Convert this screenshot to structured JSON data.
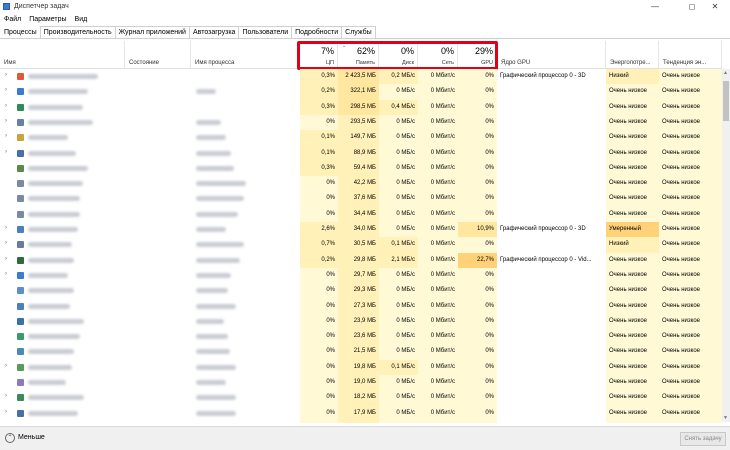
{
  "window": {
    "title": "Диспетчер задач"
  },
  "menu": [
    "Файл",
    "Параметры",
    "Вид"
  ],
  "tabs": [
    "Процессы",
    "Производительность",
    "Журнал приложений",
    "Автозагрузка",
    "Пользователи",
    "Подробности",
    "Службы"
  ],
  "header": {
    "name": "Имя",
    "status": "Состояние",
    "process_name": "Имя процесса",
    "cpu": {
      "pct": "7%",
      "label": "ЦП"
    },
    "mem": {
      "pct": "62%",
      "label": "Память"
    },
    "disk": {
      "pct": "0%",
      "label": "Диск"
    },
    "net": {
      "pct": "0%",
      "label": "Сеть"
    },
    "gpu": {
      "pct": "29%",
      "label": "GPU"
    },
    "gpu_engine": "Ядро GPU",
    "power": "Энергопотре...",
    "power_trend": "Тенденция эн..."
  },
  "rows": [
    {
      "cpu": "0,3%",
      "mem": "2 423,5 МБ",
      "disk": "0,2 МБ/с",
      "net": "0 Мбит/с",
      "gpu": "0%",
      "engine": "Графический процессор 0 - 3D",
      "power": "Низкий",
      "trend": "Очень низкое"
    },
    {
      "cpu": "0,2%",
      "mem": "322,1 МБ",
      "disk": "0 МБ/с",
      "net": "0 Мбит/с",
      "gpu": "0%",
      "engine": "",
      "power": "Очень низкое",
      "trend": "Очень низкое"
    },
    {
      "cpu": "0,3%",
      "mem": "298,5 МБ",
      "disk": "0,4 МБ/с",
      "net": "0 Мбит/с",
      "gpu": "0%",
      "engine": "",
      "power": "Очень низкое",
      "trend": "Очень низкое"
    },
    {
      "cpu": "0%",
      "mem": "293,5 МБ",
      "disk": "0 МБ/с",
      "net": "0 Мбит/с",
      "gpu": "0%",
      "engine": "",
      "power": "Очень низкое",
      "trend": "Очень низкое"
    },
    {
      "cpu": "0,1%",
      "mem": "149,7 МБ",
      "disk": "0 МБ/с",
      "net": "0 Мбит/с",
      "gpu": "0%",
      "engine": "",
      "power": "Очень низкое",
      "trend": "Очень низкое"
    },
    {
      "cpu": "0,1%",
      "mem": "88,9 МБ",
      "disk": "0 МБ/с",
      "net": "0 Мбит/с",
      "gpu": "0%",
      "engine": "",
      "power": "Очень низкое",
      "trend": "Очень низкое"
    },
    {
      "cpu": "0,3%",
      "mem": "59,4 МБ",
      "disk": "0 МБ/с",
      "net": "0 Мбит/с",
      "gpu": "0%",
      "engine": "",
      "power": "Очень низкое",
      "trend": "Очень низкое"
    },
    {
      "cpu": "0%",
      "mem": "42,2 МБ",
      "disk": "0 МБ/с",
      "net": "0 Мбит/с",
      "gpu": "0%",
      "engine": "",
      "power": "Очень низкое",
      "trend": "Очень низкое"
    },
    {
      "cpu": "0%",
      "mem": "37,6 МБ",
      "disk": "0 МБ/с",
      "net": "0 Мбит/с",
      "gpu": "0%",
      "engine": "",
      "power": "Очень низкое",
      "trend": "Очень низкое"
    },
    {
      "cpu": "0%",
      "mem": "34,4 МБ",
      "disk": "0 МБ/с",
      "net": "0 Мбит/с",
      "gpu": "0%",
      "engine": "",
      "power": "Очень низкое",
      "trend": "Очень низкое"
    },
    {
      "cpu": "2,6%",
      "mem": "34,0 МБ",
      "disk": "0 МБ/с",
      "net": "0 Мбит/с",
      "gpu": "10,9%",
      "engine": "Графический процессор 0 - 3D",
      "power": "Умеренный",
      "trend": "Очень низкое"
    },
    {
      "cpu": "0,7%",
      "mem": "30,5 МБ",
      "disk": "0,1 МБ/с",
      "net": "0 Мбит/с",
      "gpu": "0%",
      "engine": "",
      "power": "Низкий",
      "trend": "Очень низкое"
    },
    {
      "cpu": "0,2%",
      "mem": "29,8 МБ",
      "disk": "2,1 МБ/с",
      "net": "0 Мбит/с",
      "gpu": "22,7%",
      "engine": "Графический процессор 0 - Vid...",
      "power": "Очень низкое",
      "trend": "Очень низкое"
    },
    {
      "cpu": "0%",
      "mem": "29,7 МБ",
      "disk": "0 МБ/с",
      "net": "0 Мбит/с",
      "gpu": "0%",
      "engine": "",
      "power": "Очень низкое",
      "trend": "Очень низкое"
    },
    {
      "cpu": "0%",
      "mem": "29,3 МБ",
      "disk": "0 МБ/с",
      "net": "0 Мбит/с",
      "gpu": "0%",
      "engine": "",
      "power": "Очень низкое",
      "trend": "Очень низкое"
    },
    {
      "cpu": "0%",
      "mem": "27,3 МБ",
      "disk": "0 МБ/с",
      "net": "0 Мбит/с",
      "gpu": "0%",
      "engine": "",
      "power": "Очень низкое",
      "trend": "Очень низкое"
    },
    {
      "cpu": "0%",
      "mem": "23,9 МБ",
      "disk": "0 МБ/с",
      "net": "0 Мбит/с",
      "gpu": "0%",
      "engine": "",
      "power": "Очень низкое",
      "trend": "Очень низкое"
    },
    {
      "cpu": "0%",
      "mem": "23,6 МБ",
      "disk": "0 МБ/с",
      "net": "0 Мбит/с",
      "gpu": "0%",
      "engine": "",
      "power": "Очень низкое",
      "trend": "Очень низкое"
    },
    {
      "cpu": "0%",
      "mem": "21,5 МБ",
      "disk": "0 МБ/с",
      "net": "0 Мбит/с",
      "gpu": "0%",
      "engine": "",
      "power": "Очень низкое",
      "trend": "Очень низкое"
    },
    {
      "cpu": "0%",
      "mem": "19,8 МБ",
      "disk": "0,1 МБ/с",
      "net": "0 Мбит/с",
      "gpu": "0%",
      "engine": "",
      "power": "Очень низкое",
      "trend": "Очень низкое"
    },
    {
      "cpu": "0%",
      "mem": "19,0 МБ",
      "disk": "0 МБ/с",
      "net": "0 Мбит/с",
      "gpu": "0%",
      "engine": "",
      "power": "Очень низкое",
      "trend": "Очень низкое"
    },
    {
      "cpu": "0%",
      "mem": "18,2 МБ",
      "disk": "0 МБ/с",
      "net": "0 Мбит/с",
      "gpu": "0%",
      "engine": "",
      "power": "Очень низкое",
      "trend": "Очень низкое"
    },
    {
      "cpu": "0%",
      "mem": "17,9 МБ",
      "disk": "0 МБ/с",
      "net": "0 Мбит/с",
      "gpu": "0%",
      "engine": "",
      "power": "Очень низкое",
      "trend": "Очень низкое"
    }
  ],
  "footer": {
    "less": "Меньше",
    "end_task": "Снять задачу"
  },
  "colors": {
    "cell_light": "#fff9d6",
    "cell_medium": "#fff1b8",
    "cell_mem": "#ffe7a0",
    "cell_gpu_high": "#ffd27a",
    "highlight": "#e0001b"
  }
}
